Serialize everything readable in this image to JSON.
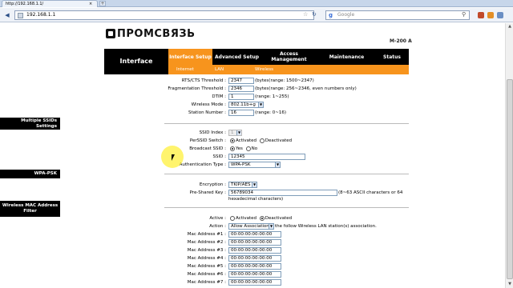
{
  "browser": {
    "tab_title": "http://192.168.1.1/",
    "tab_close": "×",
    "new_tab": "+",
    "url": "192.168.1.1",
    "search_engine": "Google",
    "search_placeholder": "Google"
  },
  "router": {
    "logo_text": "ПРОМСВЯЗЬ",
    "model": "M-200 A",
    "header_title": "Interface",
    "tabs": [
      {
        "label": "Interface Setup",
        "active": true
      },
      {
        "label": "Advanced Setup",
        "active": false
      },
      {
        "label": "Access Management",
        "active": false
      },
      {
        "label": "Maintenance",
        "active": false
      },
      {
        "label": "Status",
        "active": false
      }
    ],
    "subtabs": [
      "Internet",
      "LAN",
      "Wireless"
    ]
  },
  "wireless": {
    "rts_label": "RTS/CTS Threshold :",
    "rts_value": "2347",
    "rts_note": "(bytes(range: 1500~2347)",
    "frag_label": "Fragmentation Threshold :",
    "frag_value": "2346",
    "frag_note": "(bytes(range: 256~2346, even numbers only)",
    "dtim_label": "DTIM :",
    "dtim_value": "1",
    "dtim_note": "(range: 1~255)",
    "mode_label": "Wireless Mode :",
    "mode_value": "802.11b+g",
    "station_label": "Station Number :",
    "station_value": "16",
    "station_note": "(range: 0~16)"
  },
  "ssid": {
    "section": "Multiple SSIDs Settings",
    "index_label": "SSID Index :",
    "index_value": "1",
    "perssid_label": "PerSSID Switch :",
    "perssid_on": "Activated",
    "perssid_off": "Deactivated",
    "broadcast_label": "Broadcast SSID :",
    "broadcast_yes": "Yes",
    "broadcast_no": "No",
    "ssid_label": "SSID :",
    "ssid_value": "12345",
    "auth_label": "Authentication Type :",
    "auth_value": "WPA-PSK"
  },
  "wpa": {
    "section": "WPA-PSK",
    "enc_label": "Encryption :",
    "enc_value": "TKIP/AES",
    "key_label": "Pre-Shared Key :",
    "key_value": "56789034",
    "key_note": "(8~63 ASCII characters or 64",
    "key_note2": "hexadecimal characters)"
  },
  "mac": {
    "section": "Wireless MAC Address Filter",
    "active_label": "Active :",
    "active_on": "Activated",
    "active_off": "Deactivated",
    "action_label": "Action :",
    "action_value": "Allow Association",
    "action_note": "the follow Wireless LAN station(s) association.",
    "addresses": [
      {
        "label": "Mac Address #1 :",
        "value": "00:00:00:00:00:00"
      },
      {
        "label": "Mac Address #2 :",
        "value": "00:00:00:00:00:00"
      },
      {
        "label": "Mac Address #3 :",
        "value": "00:00:00:00:00:00"
      },
      {
        "label": "Mac Address #4 :",
        "value": "00:00:00:00:00:00"
      },
      {
        "label": "Mac Address #5 :",
        "value": "00:00:00:00:00:00"
      },
      {
        "label": "Mac Address #6 :",
        "value": "00:00:00:00:00:00"
      },
      {
        "label": "Mac Address #7 :",
        "value": "00:00:00:00:00:00"
      }
    ]
  },
  "colors": {
    "accent": "#f7941d",
    "dark": "#000000"
  }
}
